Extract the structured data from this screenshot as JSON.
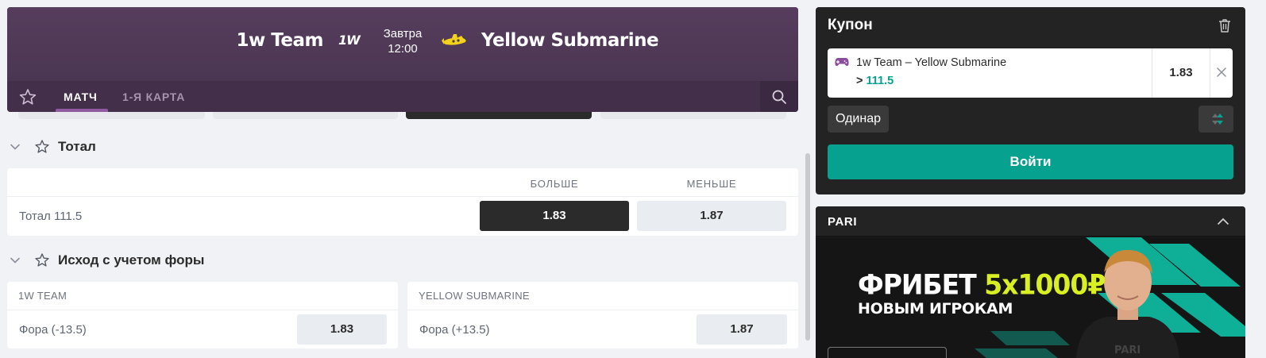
{
  "match": {
    "team_home": "1w Team",
    "team_home_logo_text": "1W",
    "team_away": "Yellow Submarine",
    "day": "Завтра",
    "time": "12:00",
    "tabs": [
      {
        "label": "МАТЧ",
        "active": true
      },
      {
        "label": "1-Я КАРТА",
        "active": false
      }
    ],
    "icons": {
      "favorite": "star-icon",
      "search": "search-icon",
      "away_logo": "submarine-logo-icon"
    }
  },
  "markets": {
    "total": {
      "title": "Тотал",
      "col_over": "БОЛЬШЕ",
      "col_under": "МЕНЬШЕ",
      "rows": [
        {
          "label": "Тотал 111.5",
          "over": "1.83",
          "under": "1.87",
          "selected": "over"
        }
      ]
    },
    "handicap": {
      "title": "Исход с учетом форы",
      "home_label": "1W TEAM",
      "away_label": "YELLOW SUBMARINE",
      "home_row": {
        "label": "Фора (-13.5)",
        "odds": "1.83"
      },
      "away_row": {
        "label": "Фора (+13.5)",
        "odds": "1.87"
      }
    }
  },
  "coupon": {
    "title": "Купон",
    "bet": {
      "event": "1w Team – Yellow Submarine",
      "pick_prefix": ">",
      "pick_value": "111.5",
      "odds": "1.83"
    },
    "bet_type": "Одинар",
    "login_label": "Войти",
    "icons": {
      "clear": "trash-icon",
      "remove": "close-icon",
      "game": "gamepad-icon",
      "sort": "sort-icon"
    }
  },
  "promo": {
    "title": "PARI",
    "banner_line1_a": "ФРИБЕТ",
    "banner_line1_b": "5х1000₽",
    "banner_line2": "НОВЫМ ИГРОКАМ",
    "colors": {
      "accent": "#d8f023",
      "stripes": "#0fb89f"
    }
  },
  "colors": {
    "header_bg": "#4f3957",
    "accent_green": "#06a28f",
    "selected_odds": "#2b2b2b",
    "page_bg": "#f1f2f5"
  }
}
